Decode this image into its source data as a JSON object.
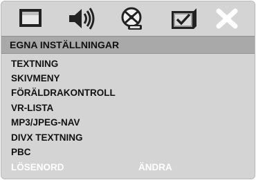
{
  "toolbar": {
    "icons": [
      "general-setup-icon",
      "audio-setup-icon",
      "disc-setup-icon",
      "preference-setup-icon",
      "exit-icon"
    ]
  },
  "header": {
    "title": "EGNA INSTÄLLNINGAR"
  },
  "menu": {
    "items": [
      {
        "label": "TEXTNING"
      },
      {
        "label": "SKIVMENY"
      },
      {
        "label": "FÖRÄLDRAKONTROLL"
      },
      {
        "label": "VR-LISTA"
      },
      {
        "label": "MP3/JPEG-NAV"
      },
      {
        "label": "DIVX TEXTNING"
      },
      {
        "label": "PBC"
      }
    ],
    "password": {
      "label": "LÖSENORD",
      "value": "ÄNDRA"
    }
  },
  "colors": {
    "panel": "#d4d4d4",
    "header": "#a9a9a9",
    "disabled_text": "#ffffff"
  }
}
